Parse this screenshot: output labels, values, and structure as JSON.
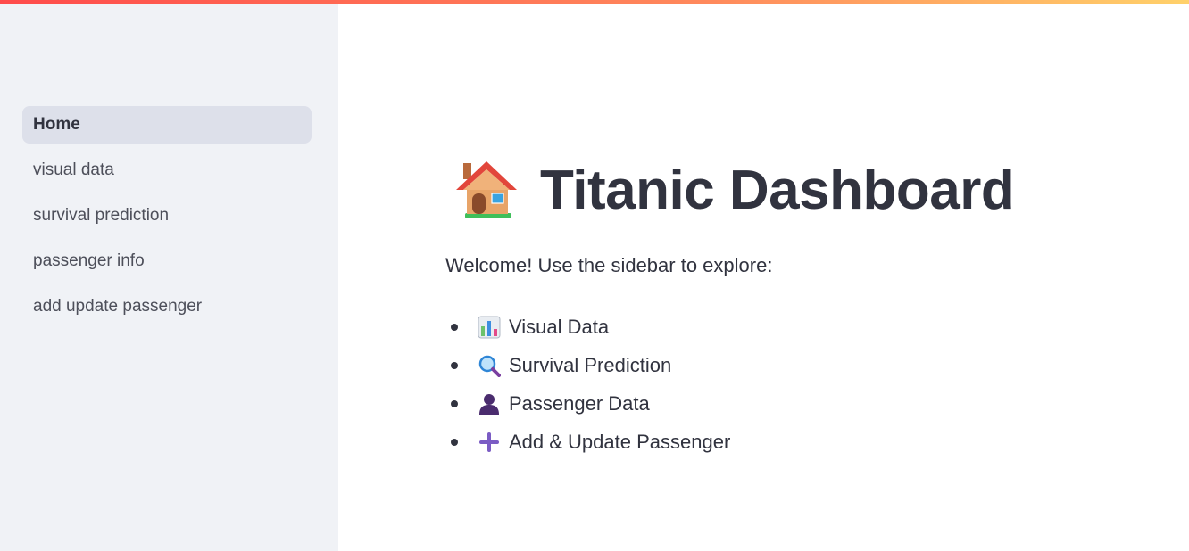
{
  "sidebar": {
    "items": [
      {
        "label": "Home",
        "active": true
      },
      {
        "label": "visual data",
        "active": false
      },
      {
        "label": "survival prediction",
        "active": false
      },
      {
        "label": "passenger info",
        "active": false
      },
      {
        "label": "add update passenger",
        "active": false
      }
    ]
  },
  "main": {
    "title_icon": "house-icon",
    "title": "Titanic Dashboard",
    "intro": "Welcome! Use the sidebar to explore:",
    "features": [
      {
        "icon": "bar-chart-icon",
        "label": "Visual Data"
      },
      {
        "icon": "magnifier-icon",
        "label": "Survival Prediction"
      },
      {
        "icon": "person-silhouette-icon",
        "label": "Passenger Data"
      },
      {
        "icon": "plus-icon",
        "label": "Add & Update Passenger"
      }
    ]
  },
  "colors": {
    "accent_gradient_start": "#ff4b4b",
    "accent_gradient_end": "#ffd16a",
    "sidebar_bg": "#f0f2f6",
    "active_item_bg": "#dde0ea",
    "text": "#31333f"
  }
}
